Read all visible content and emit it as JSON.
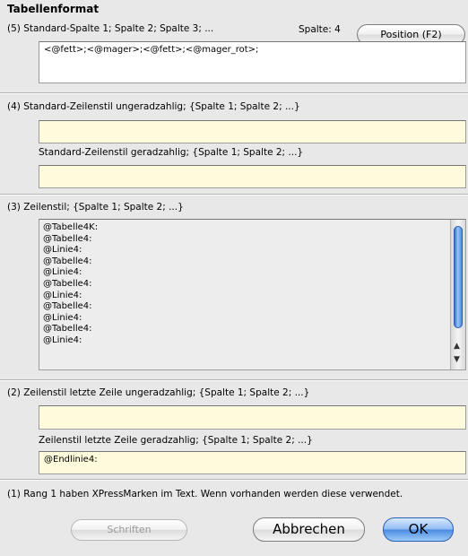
{
  "dialog": {
    "title": "Tabellenformat"
  },
  "section5": {
    "label": "(5) Standard-Spalte 1; Spalte 2; Spalte 3; ...",
    "column_label": "Spalte: 4",
    "position_button": "Position (F2)",
    "field_value": "<@fett>;<@mager>;<@fett>;<@mager_rot>;"
  },
  "section4": {
    "odd_label": "(4) Standard-Zeilenstil ungeradzahlig; {Spalte 1; Spalte 2; ...}",
    "odd_value": "",
    "even_label": "Standard-Zeilenstil geradzahlig; {Spalte 1; Spalte 2; ...}",
    "even_value": ""
  },
  "section3": {
    "label": "(3) Zeilenstil; {Spalte 1; Spalte 2; ...}",
    "items": [
      "@Tabelle4K:",
      "@Tabelle4:",
      "@Linie4:",
      "@Tabelle4:",
      "@Linie4:",
      "@Tabelle4:",
      "@Linie4:",
      "@Tabelle4:",
      "@Linie4:",
      "@Tabelle4:",
      "@Linie4:"
    ],
    "scroll_up": "▲",
    "scroll_down": "▼"
  },
  "section2": {
    "odd_label": "(2) Zeilenstil letzte Zeile ungeradzahlig; {Spalte 1; Spalte 2; ...}",
    "odd_value": "",
    "even_label": "Zeilenstil letzte Zeile geradzahlig; {Spalte 1; Spalte 2; ...}",
    "even_value": "@Endlinie4:"
  },
  "section1": {
    "note": "(1) Rang 1 haben XPressMarken im Text. Wenn vorhanden werden diese verwendet."
  },
  "buttons": {
    "fonts": "Schriften",
    "cancel": "Abbrechen",
    "ok": "OK"
  },
  "colors": {
    "field_yellow": "#fdfbdb",
    "accent_blue": "#4a8ae3"
  }
}
